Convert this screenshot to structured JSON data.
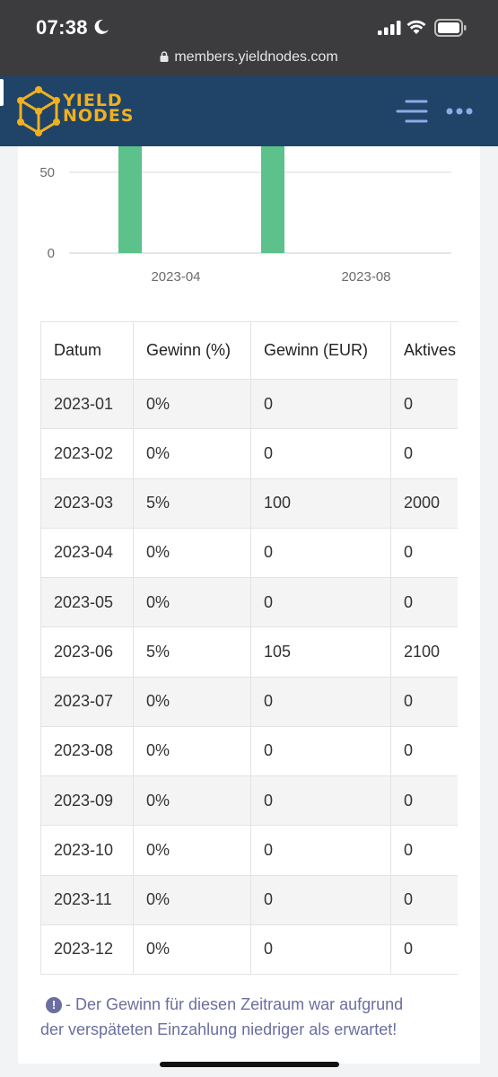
{
  "status_bar": {
    "time": "07:38"
  },
  "browser": {
    "url": "members.yieldnodes.com"
  },
  "header": {
    "logo_line1": "YIELD",
    "logo_line2": "NODES"
  },
  "chart_data": {
    "type": "bar",
    "x": [
      "2023-01",
      "2023-02",
      "2023-03",
      "2023-04",
      "2023-05",
      "2023-06",
      "2023-07",
      "2023-08",
      "2023-09",
      "2023-10",
      "2023-11",
      "2023-12"
    ],
    "values": [
      0,
      0,
      100,
      0,
      0,
      105,
      0,
      0,
      0,
      0,
      0,
      0
    ],
    "y_ticks": [
      "50",
      "0"
    ],
    "x_ticks": [
      "2023-04",
      "2023-08",
      "2023-12"
    ],
    "color": "#5cc18a",
    "grid": true
  },
  "table": {
    "headers": [
      "Datum",
      "Gewinn (%)",
      "Gewinn (EUR)",
      "Aktives"
    ],
    "rows": [
      [
        "2023-01",
        "0%",
        "0",
        "0"
      ],
      [
        "2023-02",
        "0%",
        "0",
        "0"
      ],
      [
        "2023-03",
        "5%",
        "100",
        "2000"
      ],
      [
        "2023-04",
        "0%",
        "0",
        "0"
      ],
      [
        "2023-05",
        "0%",
        "0",
        "0"
      ],
      [
        "2023-06",
        "5%",
        "105",
        "2100"
      ],
      [
        "2023-07",
        "0%",
        "0",
        "0"
      ],
      [
        "2023-08",
        "0%",
        "0",
        "0"
      ],
      [
        "2023-09",
        "0%",
        "0",
        "0"
      ],
      [
        "2023-10",
        "0%",
        "0",
        "0"
      ],
      [
        "2023-11",
        "0%",
        "0",
        "0"
      ],
      [
        "2023-12",
        "0%",
        "0",
        "0"
      ]
    ]
  },
  "note": {
    "icon": "exclamation-icon",
    "line1": "- Der Gewinn für diesen Zeitraum war aufgrund",
    "line2": "der verspäteten Einzahlung niedriger als erwartet!"
  }
}
